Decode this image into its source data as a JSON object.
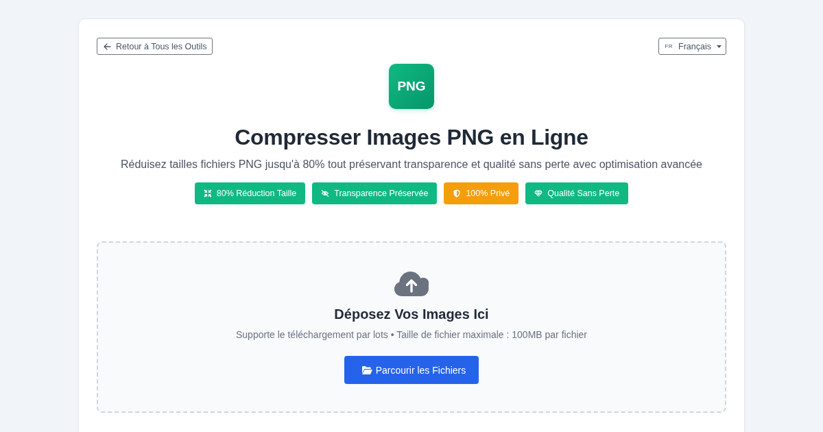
{
  "back_button": {
    "label": "Retour à Tous les Outils"
  },
  "language_selector": {
    "code": "FR",
    "label": "Français"
  },
  "logo": {
    "text": "PNG"
  },
  "title": "Compresser Images PNG en Ligne",
  "subtitle": "Réduisez tailles fichiers PNG jusqu'à 80% tout préservant transparence et qualité sans perte avec optimisation avancée",
  "badges": [
    {
      "kind": "compress",
      "label": "80% Réduction Taille",
      "color": "#10b981"
    },
    {
      "kind": "transparency",
      "label": "Transparence Préservée",
      "color": "#10b981"
    },
    {
      "kind": "privacy",
      "label": "100% Privé",
      "color": "#f59e0b"
    },
    {
      "kind": "quality",
      "label": "Qualité Sans Perte",
      "color": "#10b981"
    }
  ],
  "drop_zone": {
    "title": "Déposez Vos Images Ici",
    "hint": "Supporte le téléchargement par lots • Taille de fichier maximale : 100MB par fichier",
    "button": {
      "label": "Parcourir les Fichiers"
    }
  }
}
